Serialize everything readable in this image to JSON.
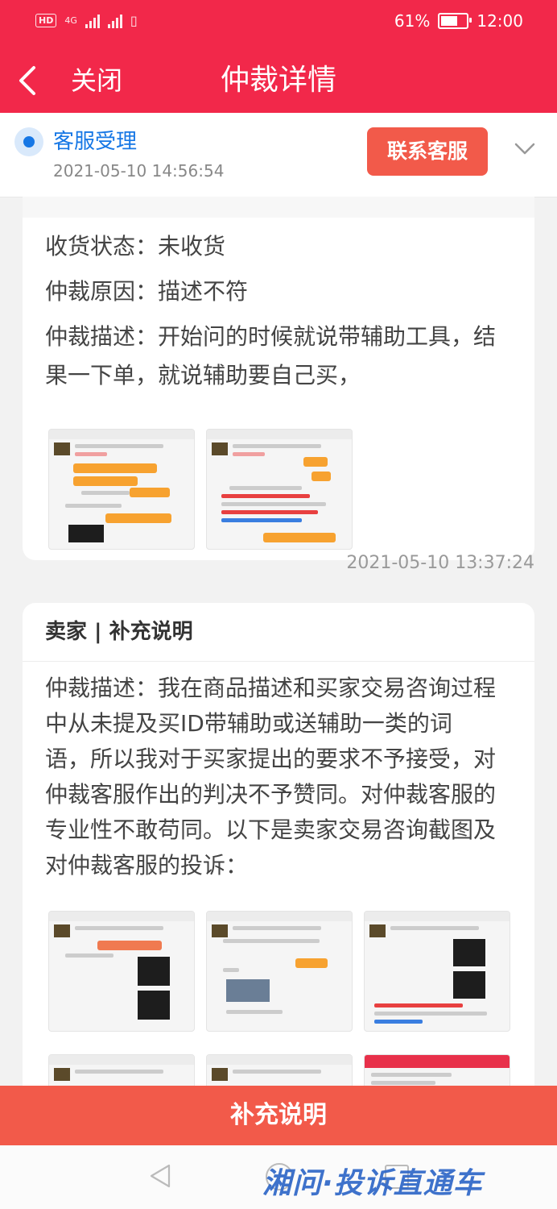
{
  "status_bar": {
    "hd": "HD",
    "net": "4G",
    "battery_percent": "61%",
    "battery_level": 0.61,
    "time": "12:00"
  },
  "nav": {
    "close": "关闭",
    "title": "仲裁详情"
  },
  "progress": {
    "stage": "客服受理",
    "time": "2021-05-10 14:56:54",
    "contact_button": "联系客服"
  },
  "buyer_card": {
    "receipt_status": "收货状态：未收货",
    "reason": "仲裁原因：描述不符",
    "description": "仲裁描述：开始问的时候就说带辅助工具，结果一下单，就说辅助要自己买，",
    "screenshot_count": 2
  },
  "buyer_timestamp": "2021-05-10 13:37:24",
  "seller_card": {
    "header": "卖家 | 补充说明",
    "description": "仲裁描述：我在商品描述和买家交易咨询过程中从未提及买ID带辅助或送辅助一类的词语，所以我对于买家提出的要求不予接受，对仲裁客服作出的判决不予赞同。对仲裁客服的专业性不敢苟同。以下是卖家交易咨询截图及对仲裁客服的投诉："
  },
  "bottom_button": "补充说明",
  "watermark": "湘问·投诉直通车",
  "colors": {
    "brand_red": "#f2284a",
    "button_red": "#f25a4a",
    "accent_blue": "#1677e5"
  }
}
